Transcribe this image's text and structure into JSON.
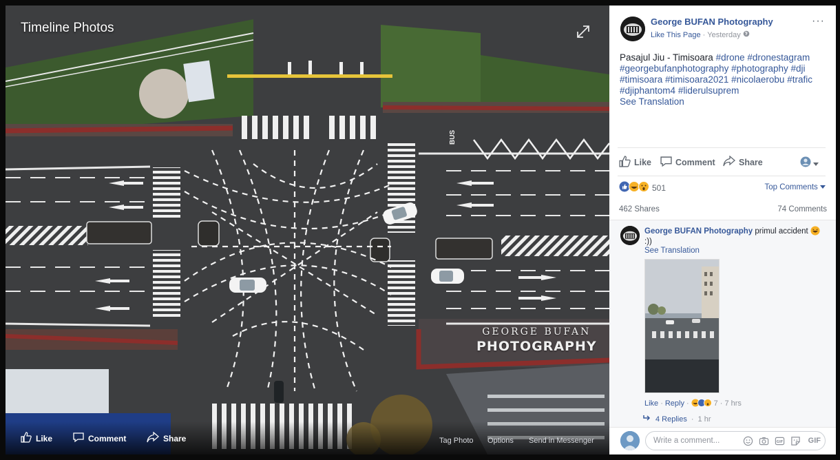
{
  "photo": {
    "title": "Timeline Photos",
    "watermark_line1": "GEORGE BUFAN",
    "watermark_line2": "PHOTOGRAPHY",
    "bus_lane_text": "BUS",
    "actions": {
      "like": "Like",
      "comment": "Comment",
      "share": "Share",
      "tag_photo": "Tag Photo",
      "options": "Options",
      "send_in_messenger": "Send in Messenger"
    }
  },
  "post": {
    "page_name": "George BUFAN Photography",
    "like_page": "Like This Page",
    "separator": "·",
    "time": "Yesterday",
    "more": "···",
    "caption_text": "Pasajul Jiu - Timisoara",
    "hashtags": [
      "#drone",
      "#dronestagram",
      "#georgebufanphotography",
      "#photography",
      "#dji",
      "#timisoara",
      "#timisoara2021",
      "#nicolaerobu",
      "#trafic",
      "#djiphantom4",
      "#liderulsuprem"
    ],
    "see_translation": "See Translation",
    "like_label": "Like",
    "comment_label": "Comment",
    "share_label": "Share",
    "reactions_count": "501",
    "top_comments": "Top Comments",
    "shares": "462 Shares",
    "comments_count": "74 Comments"
  },
  "comment": {
    "author": "George BUFAN Photography",
    "text": "primul accident",
    "text_suffix": ":))",
    "see_translation": "See Translation",
    "like": "Like",
    "reply": "Reply",
    "reaction_count": "7",
    "time": "7 hrs",
    "replies": "4 Replies",
    "replies_time": "1 hr"
  },
  "composer": {
    "placeholder": "Write a comment...",
    "gif": "GIF"
  },
  "colors": {
    "link": "#365899",
    "muted": "#90949c",
    "like_blue": "#4267b2",
    "haha_yellow": "#f7b125"
  }
}
